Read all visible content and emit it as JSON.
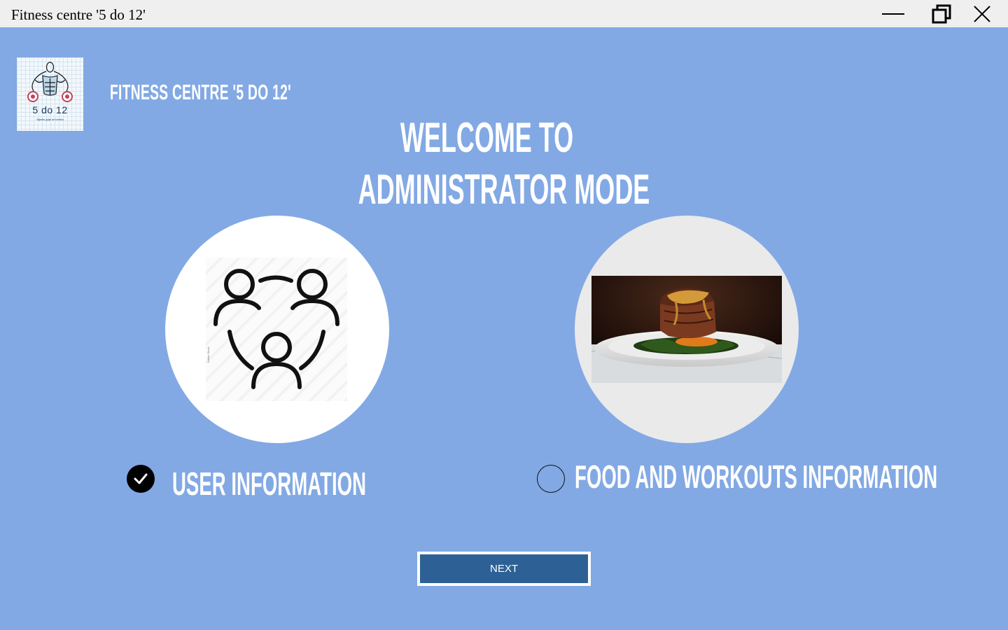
{
  "window": {
    "title": "Fitness centre '5 do 12'"
  },
  "logo": {
    "text": "5 do 12",
    "tagline": "Mjesto gdje se trenira"
  },
  "header": {
    "brand_title": "FITNESS CENTRE '5 DO 12'",
    "welcome_line1": "WELCOME TO",
    "welcome_line2": "ADMINISTRATOR MODE"
  },
  "options": [
    {
      "label": "USER INFORMATION",
      "selected": true,
      "image": "users-group-icon"
    },
    {
      "label": "FOOD AND WORKOUTS INFORMATION",
      "selected": false,
      "image": "steak-plate-photo"
    }
  ],
  "actions": {
    "next_label": "NEXT"
  },
  "colors": {
    "background": "#82a9e4",
    "titlebar": "#efefef",
    "button": "#2d6195",
    "text": "#ffffff"
  }
}
